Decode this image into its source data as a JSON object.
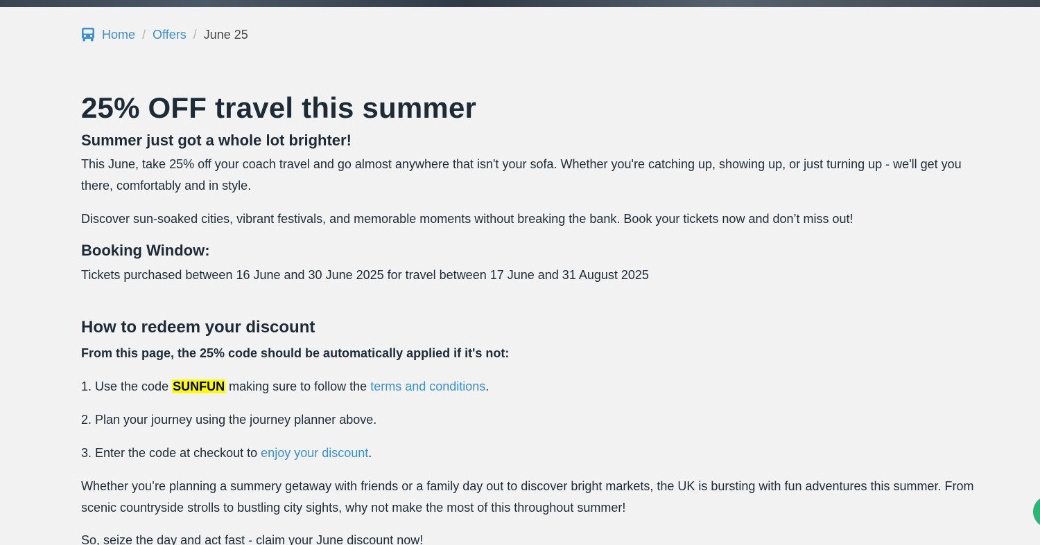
{
  "breadcrumb": {
    "icon": "bus-icon",
    "items": [
      "Home",
      "Offers"
    ],
    "current": "June 25",
    "separator": "/"
  },
  "page": {
    "title": "25% OFF travel this summer",
    "subtitle": "Summer just got a whole lot brighter!",
    "intro_p1": "This June, take 25% off your coach travel and go almost anywhere that isn't your sofa. Whether you're catching up, showing up, or just turning up - we'll get you there, comfortably and in style.",
    "intro_p2": "Discover sun-soaked cities, vibrant festivals, and memorable moments without breaking the bank. Book your tickets now and don’t miss out!",
    "booking_title": "Booking Window:",
    "booking_text": "Tickets purchased between 16 June and 30 June 2025 for travel between 17 June and 31 August 2025",
    "redeem_title": "How to redeem your discount",
    "redeem_intro": "From this page, the 25% code should be automatically applied if it's not:",
    "step1_prefix": "1. Use the code ",
    "step1_code": "SUNFUN",
    "step1_middle": " making sure to follow the ",
    "step1_link": "terms and conditions",
    "step1_suffix": ".",
    "step2": "2. Plan your journey using the journey planner above.",
    "step3_prefix": "3. Enter the code at checkout to ",
    "step3_link": "enjoy your discount",
    "step3_suffix": ".",
    "closing_p1": "Whether you’re planning a summery getaway with friends or a family day out to discover bright markets, the UK is bursting with fun adventures this summer. From scenic countryside strolls to bustling city sights, why not make the most of this throughout summer!",
    "closing_p2": "So, seize the day and act fast - claim your June discount now!"
  },
  "colors": {
    "background": "#f2f2f2",
    "text": "#1d2b36",
    "link": "#3d8fcf",
    "code_highlight": "#ffff00",
    "chat_button": "#2bb673"
  },
  "chat": {
    "icon": "chat-icon"
  }
}
